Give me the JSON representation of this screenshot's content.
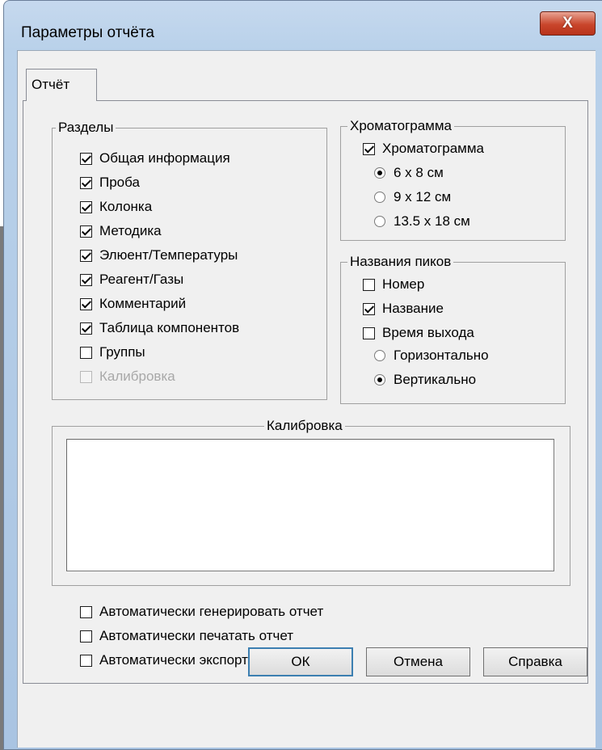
{
  "window": {
    "title": "Параметры отчёта",
    "close_glyph": "X"
  },
  "tabs": [
    {
      "label": "Отчёт",
      "active": true
    }
  ],
  "sections": {
    "legend": "Разделы",
    "items": [
      {
        "label": "Общая информация",
        "checked": true,
        "enabled": true
      },
      {
        "label": "Проба",
        "checked": true,
        "enabled": true
      },
      {
        "label": "Колонка",
        "checked": true,
        "enabled": true
      },
      {
        "label": "Методика",
        "checked": true,
        "enabled": true
      },
      {
        "label": "Элюент/Температуры",
        "checked": true,
        "enabled": true
      },
      {
        "label": "Реагент/Газы",
        "checked": true,
        "enabled": true
      },
      {
        "label": "Комментарий",
        "checked": true,
        "enabled": true
      },
      {
        "label": "Таблица компонентов",
        "checked": true,
        "enabled": true
      },
      {
        "label": "Группы",
        "checked": false,
        "enabled": true
      },
      {
        "label": "Калибровка",
        "checked": false,
        "enabled": false
      }
    ]
  },
  "chromatogram": {
    "legend": "Хроматограмма",
    "checkbox": {
      "label": "Хроматограмма",
      "checked": true
    },
    "sizes": [
      {
        "label": "6 x 8 см",
        "selected": true
      },
      {
        "label": "9 x 12 см",
        "selected": false
      },
      {
        "label": "13.5 x 18 см",
        "selected": false
      }
    ]
  },
  "peak_names": {
    "legend": "Названия пиков",
    "items": [
      {
        "label": "Номер",
        "checked": false
      },
      {
        "label": "Название",
        "checked": true
      },
      {
        "label": "Время выхода",
        "checked": false
      }
    ],
    "orientation": [
      {
        "label": "Горизонтально",
        "selected": false
      },
      {
        "label": "Вертикально",
        "selected": true
      }
    ]
  },
  "calibration": {
    "legend": "Калибровка"
  },
  "auto_options": [
    {
      "label": "Автоматически генерировать отчет",
      "checked": false
    },
    {
      "label": "Автоматически печатать отчет",
      "checked": false
    },
    {
      "label": "Автоматически экспортировать отчет",
      "checked": false
    }
  ],
  "buttons": {
    "ok": "ОК",
    "cancel": "Отмена",
    "help": "Справка"
  },
  "colors": {
    "frame": "#b9d1ea",
    "close_button": "#c9462c",
    "client": "#f0f0f0",
    "default_button_border": "#3c7fb1"
  }
}
